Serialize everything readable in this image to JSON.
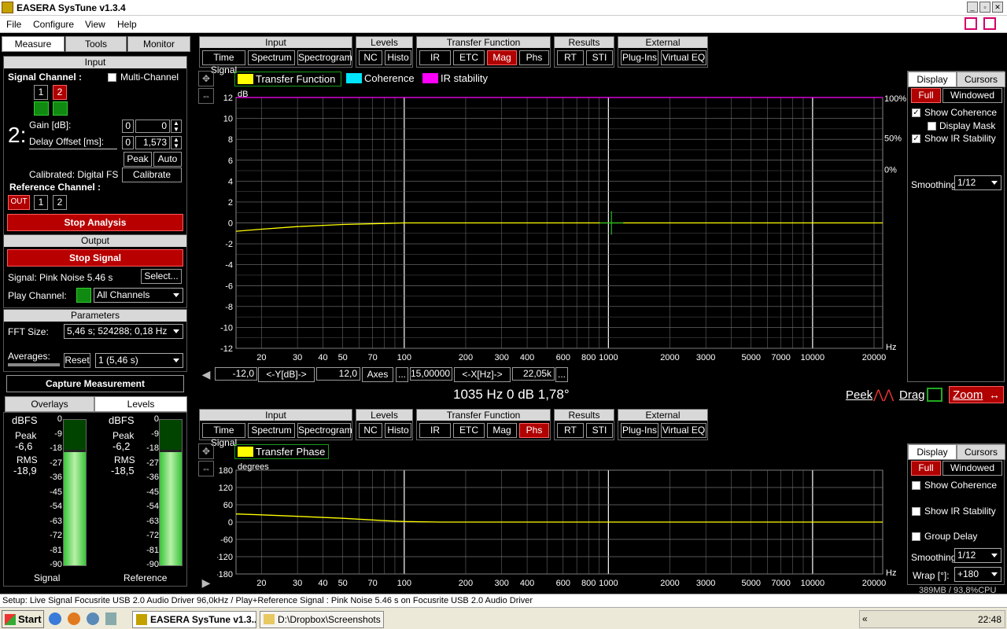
{
  "window": {
    "title": "EASERA SysTune v1.3.4"
  },
  "menu": [
    "File",
    "Configure",
    "View",
    "Help"
  ],
  "left_tabs": [
    "Measure",
    "Tools",
    "Monitor"
  ],
  "input": {
    "header": "Input",
    "signal_channel": "Signal Channel :",
    "multi_channel": "Multi-Channel",
    "ch1": "1",
    "ch2": "2",
    "big_num": "2:",
    "gain_label": "Gain [dB]:",
    "gain_small": "0",
    "gain_value": "0",
    "delay_label": "Delay Offset [ms]:",
    "delay_small": "0",
    "delay_value": "1,573",
    "peak": "Peak",
    "auto": "Auto",
    "calibrated": "Calibrated: Digital FS",
    "calibrate": "Calibrate",
    "ref_channel": "Reference Channel :",
    "ref_out": "OUT",
    "ref1": "1",
    "ref2": "2",
    "stop_analysis": "Stop Analysis"
  },
  "output": {
    "header": "Output",
    "stop_signal": "Stop Signal",
    "signal": "Signal: Pink Noise  5.46 s",
    "select": "Select...",
    "play_channel": "Play Channel:",
    "play_value": "All Channels"
  },
  "parameters": {
    "header": "Parameters",
    "fft_label": "FFT Size:",
    "fft_value": "5,46 s; 524288; 0,18 Hz",
    "avg_label": "Averages:",
    "reset": "Reset",
    "avg_value": "1 (5,46 s)"
  },
  "capture": "Capture Measurement",
  "lower_tabs": [
    "Overlays",
    "Levels"
  ],
  "meters": {
    "unit": "dBFS",
    "ticks": [
      "0",
      "-9",
      "-18",
      "-27",
      "-36",
      "-45",
      "-54",
      "-63",
      "-72",
      "-81",
      "-90"
    ],
    "signal": {
      "peak_label": "Peak",
      "peak": "-6,6",
      "rms_label": "RMS",
      "rms": "-18,9",
      "name": "Signal",
      "level": 0.79
    },
    "reference": {
      "peak_label": "Peak",
      "peak": "-6,2",
      "rms_label": "RMS",
      "rms": "-18,5",
      "name": "Reference",
      "level": 0.79
    }
  },
  "toolbar": {
    "groups": [
      {
        "title": "Input",
        "buttons": [
          "Time Signal",
          "Spectrum",
          "Spectrogram"
        ]
      },
      {
        "title": "Levels",
        "buttons": [
          "NC",
          "Histo"
        ]
      },
      {
        "title": "Transfer Function",
        "buttons": [
          "IR",
          "ETC",
          "Mag",
          "Phs"
        ]
      },
      {
        "title": "Results",
        "buttons": [
          "RT",
          "STI"
        ]
      },
      {
        "title": "External",
        "buttons": [
          "Plug-Ins",
          "Virtual EQ"
        ]
      }
    ]
  },
  "top_chart": {
    "legend": [
      "Transfer Function",
      "Coherence",
      "IR stability"
    ],
    "legend_colors": [
      "#ffff00",
      "#00e5ff",
      "#ff00ff"
    ],
    "yunit": "dB",
    "xunit": "Hz",
    "yticks": [
      "12",
      "10",
      "8",
      "6",
      "4",
      "2",
      "0",
      "-2",
      "-4",
      "-6",
      "-8",
      "-10",
      "-12"
    ],
    "right_ticks": [
      "100%",
      "50%",
      "0%"
    ],
    "xticks": [
      "20",
      "30",
      "40",
      "50",
      "70",
      "100",
      "200",
      "300",
      "400",
      "600",
      "800",
      "1000",
      "2000",
      "3000",
      "5000",
      "7000",
      "10000",
      "20000"
    ],
    "active_button": "Mag"
  },
  "chart_data": [
    {
      "type": "line",
      "title": "",
      "xlabel": "Hz",
      "ylabel": "dB",
      "xscale": "log",
      "xlim": [
        15,
        22050
      ],
      "ylim": [
        -12,
        12
      ],
      "series": [
        {
          "name": "Transfer Function",
          "color": "#ffff00",
          "x": [
            15,
            20,
            30,
            50,
            80,
            100,
            1000,
            10000,
            22050
          ],
          "y": [
            -0.8,
            -0.6,
            -0.35,
            -0.15,
            -0.05,
            0,
            0,
            0,
            0
          ]
        },
        {
          "name": "IR stability",
          "color": "#ff00ff",
          "x": [
            15,
            22050
          ],
          "y": [
            12,
            12
          ]
        }
      ]
    },
    {
      "type": "line",
      "title": "",
      "xlabel": "Hz",
      "ylabel": "degrees",
      "xscale": "log",
      "xlim": [
        15,
        22050
      ],
      "ylim": [
        -180,
        180
      ],
      "series": [
        {
          "name": "Transfer Phase",
          "color": "#ffff00",
          "x": [
            15,
            20,
            30,
            50,
            80,
            100,
            150,
            1000,
            22050
          ],
          "y": [
            28,
            25,
            20,
            13,
            5,
            2,
            0,
            0,
            0
          ]
        }
      ]
    }
  ],
  "axis_bar": {
    "ymin": "-12,0",
    "ylabel": "<-Y[dB]->",
    "ymax": "12,0",
    "axes": "Axes",
    "dots": "...",
    "xmin": "15,00000",
    "xlabel": "<-X[Hz]->",
    "xmax": "22,05k"
  },
  "readout": {
    "text": "1035 Hz   0 dB  1,78°",
    "peek": "Peek",
    "drag": "Drag",
    "zoom": "Zoom"
  },
  "bottom_chart": {
    "legend": [
      "Transfer Phase"
    ],
    "yunit": "degrees",
    "yticks": [
      "180",
      "120",
      "60",
      "0",
      "-60",
      "-120",
      "-180"
    ],
    "active_button": "Phs"
  },
  "side_top": {
    "tabs": [
      "Display",
      "Cursors"
    ],
    "full": "Full",
    "windowed": "Windowed",
    "show_coherence": "Show Coherence",
    "display_mask": "Display Mask",
    "show_ir": "Show IR Stability",
    "smoothing_label": "Smoothing:",
    "smoothing": "1/12"
  },
  "side_bottom": {
    "tabs": [
      "Display",
      "Cursors"
    ],
    "full": "Full",
    "windowed": "Windowed",
    "show_coherence": "Show Coherence",
    "show_ir": "Show IR Stability",
    "group_delay": "Group Delay",
    "smoothing_label": "Smoothing:",
    "smoothing": "1/12",
    "wrap_label": "Wrap [°]:",
    "wrap": "+180",
    "memory": "389MB / 93,8%CPU"
  },
  "status": "Setup: Live Signal Focusrite USB 2.0 Audio Driver 96,0kHz / Play+Reference Signal : Pink Noise  5.46 s on Focusrite USB 2.0 Audio Driver",
  "taskbar": {
    "start": "Start",
    "task1": "EASERA SysTune v1.3...",
    "task2": "D:\\Dropbox\\Screenshots",
    "clock": "22:48"
  }
}
